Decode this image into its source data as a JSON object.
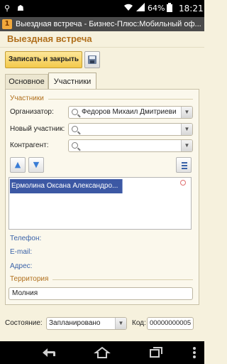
{
  "status_bar": {
    "battery": "64%",
    "time": "18:21",
    "icons": [
      "usb-icon",
      "android-icon",
      "wifi-icon",
      "cellular-signal-icon",
      "battery-icon"
    ]
  },
  "window": {
    "title": "Выездная встреча - Бизнес-Плюс:Мобильный оф..."
  },
  "page": {
    "title": "Выездная встреча"
  },
  "toolbar": {
    "save_close_label": "Записать и закрыть",
    "save_icon": "floppy-disk-icon"
  },
  "tabs": [
    {
      "label": "Основное",
      "active": false
    },
    {
      "label": "Участники",
      "active": true
    }
  ],
  "participants": {
    "group_title": "Участники",
    "organizer_label": "Организатор:",
    "organizer_value": "Федоров Михаил Дмитриеви",
    "new_participant_label": "Новый участник:",
    "new_participant_value": "",
    "counterparty_label": "Контрагент:",
    "counterparty_value": "",
    "list": [
      "Ермолина Оксана Александро..."
    ],
    "phone_label": "Телефон:",
    "email_label": "E-mail:",
    "address_label": "Адрес:"
  },
  "territory": {
    "group_title": "Территория",
    "value": "Молния"
  },
  "footer": {
    "state_label": "Состояние:",
    "state_value": "Запланировано",
    "code_label": "Код:",
    "code_value": "00000000005"
  },
  "colors": {
    "accent": "#b06f1c",
    "selection": "#3c58a4",
    "link_label": "#3a62a8",
    "background": "#f6f1dd"
  }
}
